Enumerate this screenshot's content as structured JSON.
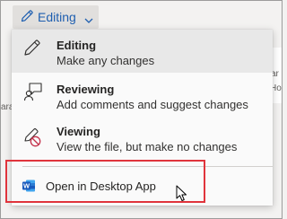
{
  "ribbon": {
    "mode_label": "Editing",
    "icons": {
      "mode": "pencil-icon",
      "dropdown": "chevron-down-icon"
    }
  },
  "background": {
    "snippets": [
      "ar",
      "Ho",
      "ara"
    ]
  },
  "menu": {
    "items": [
      {
        "title": "Editing",
        "description": "Make any changes",
        "icon": "pencil-icon",
        "selected": true
      },
      {
        "title": "Reviewing",
        "description": "Add comments and suggest changes",
        "icon": "reviewing-icon",
        "selected": false
      },
      {
        "title": "Viewing",
        "description": "View the file, but make no changes",
        "icon": "viewing-no-edit-icon",
        "selected": false
      }
    ],
    "desktop_app": {
      "label": "Open in Desktop App",
      "icon": "word-app-icon"
    }
  },
  "colors": {
    "accent": "#1f5fb0",
    "word_blue": "#185abd",
    "highlight_red": "#e0343c"
  }
}
